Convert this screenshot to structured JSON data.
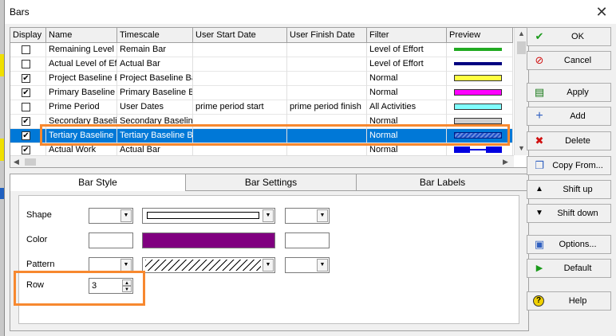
{
  "window": {
    "title": "Bars",
    "close_glyph": "✕"
  },
  "grid": {
    "columns": [
      "Display",
      "Name",
      "Timescale",
      "User Start Date",
      "User Finish Date",
      "Filter",
      "Preview"
    ],
    "rows": [
      {
        "display": false,
        "name": "Remaining Level of Effort",
        "timescale": "Remain Bar",
        "user_start": "",
        "user_finish": "",
        "filter": "Level of Effort",
        "preview": {
          "fill": "#22aa22",
          "style": "thin"
        }
      },
      {
        "display": false,
        "name": "Actual Level of Effort",
        "timescale": "Actual Bar",
        "user_start": "",
        "user_finish": "",
        "filter": "Level of Effort",
        "preview": {
          "fill": "#000080",
          "style": "thin"
        }
      },
      {
        "display": true,
        "name": "Project Baseline Bar",
        "timescale": "Project Baseline Bar",
        "user_start": "",
        "user_finish": "",
        "filter": "Normal",
        "preview": {
          "fill": "#ffff40",
          "style": "box"
        }
      },
      {
        "display": true,
        "name": "Primary Baseline",
        "timescale": "Primary Baseline Bar",
        "user_start": "",
        "user_finish": "",
        "filter": "Normal",
        "preview": {
          "fill": "#ff00ff",
          "style": "box"
        }
      },
      {
        "display": false,
        "name": "Prime Period",
        "timescale": "User Dates",
        "user_start": "prime period start",
        "user_finish": "prime period finish",
        "filter": "All Activities",
        "preview": {
          "fill": "#80ffff",
          "style": "box"
        }
      },
      {
        "display": true,
        "name": "Secondary Baseline",
        "timescale": "Secondary Baseline",
        "user_start": "",
        "user_finish": "",
        "filter": "Normal",
        "preview": {
          "fill": "#d0d0d0",
          "style": "box"
        }
      },
      {
        "display": true,
        "name": "Tertiary Baseline",
        "timescale": "Tertiary Baseline Bar",
        "user_start": "",
        "user_finish": "",
        "filter": "Normal",
        "preview": {
          "fill": "#1e50c8",
          "style": "hatch"
        },
        "selected": true
      },
      {
        "display": true,
        "name": "Actual Work",
        "timescale": "Actual Bar",
        "user_start": "",
        "user_finish": "",
        "filter": "Normal",
        "preview": {
          "fill": "#0000e0",
          "style": "split"
        }
      }
    ]
  },
  "tabs": [
    "Bar Style",
    "Bar Settings",
    "Bar Labels"
  ],
  "bar_style": {
    "shape_label": "Shape",
    "color_label": "Color",
    "pattern_label": "Pattern",
    "row_label": "Row",
    "row_value": "3",
    "middle_color": "#800080"
  },
  "buttons": {
    "ok": "OK",
    "cancel": "Cancel",
    "apply": "Apply",
    "add": "Add",
    "delete": "Delete",
    "copy_from": "Copy From...",
    "shift_up": "Shift up",
    "shift_down": "Shift down",
    "options": "Options...",
    "default": "Default",
    "help": "Help"
  },
  "icons": {
    "ok": "checkmark-icon",
    "cancel": "no-entry-icon",
    "apply": "apply-icon",
    "add": "plus-icon",
    "delete": "x-icon",
    "copy_from": "copy-icon",
    "shift_up": "triangle-up-icon",
    "shift_down": "triangle-down-icon",
    "options": "options-icon",
    "default": "play-icon",
    "help": "help-icon"
  },
  "highlight_color": "#f7882f"
}
